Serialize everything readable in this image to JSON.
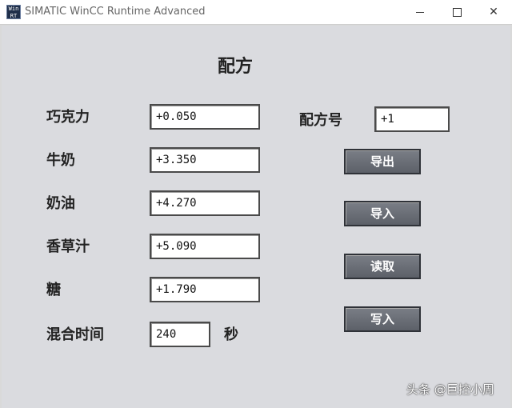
{
  "window": {
    "icon_text_top": "Win",
    "icon_text_bottom": "RT",
    "title": "SIMATIC WinCC Runtime Advanced"
  },
  "screen": {
    "title": "配方",
    "ingredients": [
      {
        "label": "巧克力",
        "value": "+0.050"
      },
      {
        "label": "牛奶",
        "value": "+3.350"
      },
      {
        "label": "奶油",
        "value": "+4.270"
      },
      {
        "label": "香草汁",
        "value": "+5.090"
      },
      {
        "label": "糖",
        "value": "+1.790"
      }
    ],
    "mix_time": {
      "label": "混合时间",
      "value": "240",
      "unit": "秒"
    },
    "recipe_number": {
      "label": "配方号",
      "value": "+1"
    },
    "buttons": {
      "export": "导出",
      "import": "导入",
      "read": "读取",
      "write": "写入"
    }
  },
  "watermark": "头条 @巨控小周",
  "colors": {
    "panel_bg": "#dadbdf",
    "button_bg": "#6a6e76",
    "field_bg": "#ffffff"
  }
}
